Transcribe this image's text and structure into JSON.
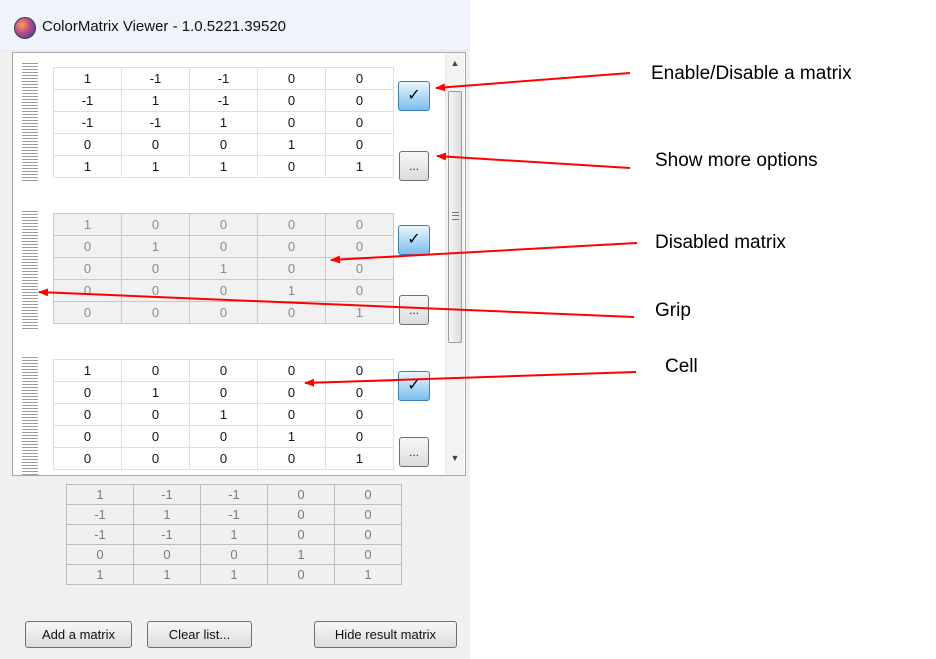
{
  "window": {
    "title": "ColorMatrix Viewer - 1.0.5221.39520"
  },
  "icons": {
    "check": "✓",
    "more": "...",
    "scroll_up": "▲",
    "scroll_down": "▼"
  },
  "matrices": [
    {
      "enabled": true,
      "rows": [
        [
          "1",
          "-1",
          "-1",
          "0",
          "0"
        ],
        [
          "-1",
          "1",
          "-1",
          "0",
          "0"
        ],
        [
          "-1",
          "-1",
          "1",
          "0",
          "0"
        ],
        [
          "0",
          "0",
          "0",
          "1",
          "0"
        ],
        [
          "1",
          "1",
          "1",
          "0",
          "1"
        ]
      ]
    },
    {
      "enabled": false,
      "rows": [
        [
          "1",
          "0",
          "0",
          "0",
          "0"
        ],
        [
          "0",
          "1",
          "0",
          "0",
          "0"
        ],
        [
          "0",
          "0",
          "1",
          "0",
          "0"
        ],
        [
          "0",
          "0",
          "0",
          "1",
          "0"
        ],
        [
          "0",
          "0",
          "0",
          "0",
          "1"
        ]
      ]
    },
    {
      "enabled": true,
      "rows": [
        [
          "1",
          "0",
          "0",
          "0",
          "0"
        ],
        [
          "0",
          "1",
          "0",
          "0",
          "0"
        ],
        [
          "0",
          "0",
          "1",
          "0",
          "0"
        ],
        [
          "0",
          "0",
          "0",
          "1",
          "0"
        ],
        [
          "0",
          "0",
          "0",
          "0",
          "1"
        ]
      ]
    }
  ],
  "result_matrix": [
    [
      "1",
      "-1",
      "-1",
      "0",
      "0"
    ],
    [
      "-1",
      "1",
      "-1",
      "0",
      "0"
    ],
    [
      "-1",
      "-1",
      "1",
      "0",
      "0"
    ],
    [
      "0",
      "0",
      "0",
      "1",
      "0"
    ],
    [
      "1",
      "1",
      "1",
      "0",
      "1"
    ]
  ],
  "buttons": {
    "add": "Add a matrix",
    "clear": "Clear list...",
    "hide": "Hide result matrix"
  },
  "annotations": {
    "enable": "Enable/Disable a matrix",
    "more": "Show more options",
    "disabled": "Disabled matrix",
    "grip": "Grip",
    "cell": "Cell"
  },
  "colors": {
    "arrow": "#ff0000",
    "check_button_top": "#eaf6fd",
    "check_button_bottom": "#7cbef0"
  }
}
